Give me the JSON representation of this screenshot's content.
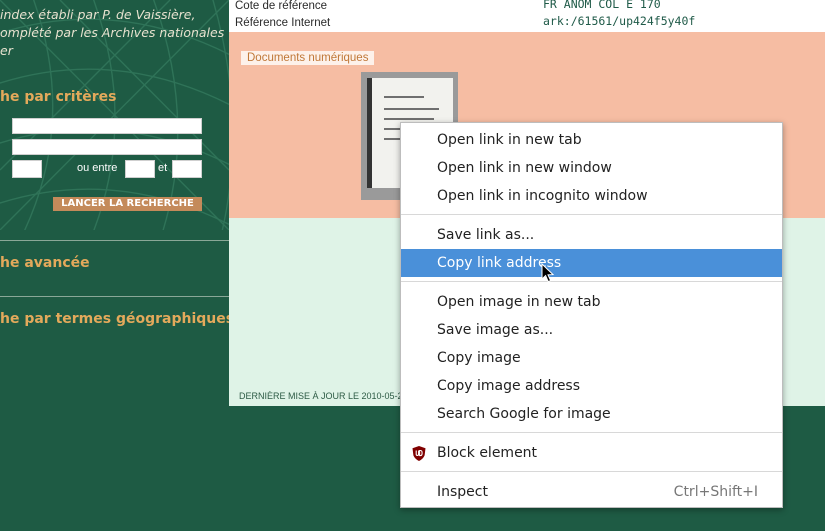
{
  "sidebar": {
    "intro_lines": [
      "index établi par P. de Vaissière,",
      "omplété par les Archives nationales",
      "er"
    ],
    "criteria_title": "he par critères",
    "search_field_1": "",
    "search_field_2": "",
    "date_from": "",
    "between_label": "ou entre",
    "date_between_start": "",
    "and_label": "et",
    "date_between_end": "",
    "search_button": "LANCER LA RECHERCHE",
    "advanced_link": "he avancée",
    "geo_link": "he par termes géographiques"
  },
  "header": {
    "cote_label": "Cote de référence",
    "cote_value": "FR ANOM COL E 170",
    "internet_label": "Référence Internet",
    "internet_value": "ark:/61561/up424f5y40f"
  },
  "documents": {
    "label": "Documents numériques"
  },
  "footer": {
    "last_update": "DERNIÈRE MISE À JOUR LE 2010-05-2"
  },
  "context_menu": {
    "items": [
      {
        "label": "Open link in new tab"
      },
      {
        "label": "Open link in new window"
      },
      {
        "label": "Open link in incognito window"
      },
      {
        "label": "Save link as..."
      },
      {
        "label": "Copy link address",
        "highlighted": true
      },
      {
        "label": "Open image in new tab"
      },
      {
        "label": "Save image as..."
      },
      {
        "label": "Copy image"
      },
      {
        "label": "Copy image address"
      },
      {
        "label": "Search Google for image"
      },
      {
        "label": "Block element",
        "icon": "ublock-shield-icon"
      },
      {
        "label": "Inspect",
        "shortcut": "Ctrl+Shift+I"
      }
    ]
  },
  "colors": {
    "sidebar_bg": "#1e5b44",
    "accent_orange": "#e3a95b",
    "doc_panel_bg": "#f6bda3",
    "lower_panel_bg": "#dff3e7",
    "menu_highlight": "#4a90d9"
  }
}
